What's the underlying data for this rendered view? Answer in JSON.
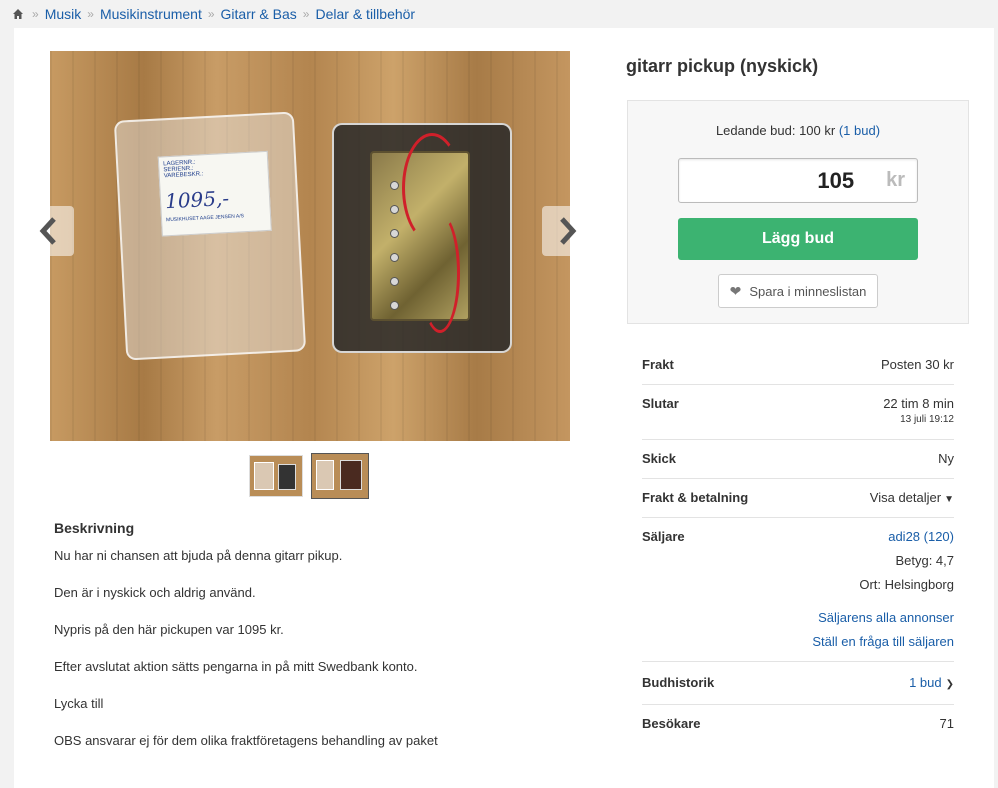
{
  "breadcrumb": {
    "home_icon": "home-icon",
    "items": [
      "Musik",
      "Musikinstrument",
      "Gitarr & Bas",
      "Delar & tillbehör"
    ],
    "separator": "»"
  },
  "listing": {
    "title": "gitarr pickup (nyskick)",
    "image": {
      "label_handwritten": "1095,-",
      "label_code": "SOPAFB1B",
      "label_lines": [
        "LAGERNR.:",
        "SERIENR.:",
        "VAREBESKR.:"
      ],
      "label_footer": "MUSIKHUSET AAGE JENSEN A/S"
    }
  },
  "bid": {
    "leading_label": "Ledande bud: 100 kr",
    "bid_count_link": "(1 bud)",
    "input_value": "105",
    "input_unit": "kr",
    "place_bid_label": "Lägg bud",
    "save_label": "Spara i minneslistan"
  },
  "details": {
    "shipping": {
      "label": "Frakt",
      "value": "Posten 30 kr"
    },
    "ends": {
      "label": "Slutar",
      "value": "22 tim 8 min",
      "sub": "13 juli 19:12"
    },
    "condition": {
      "label": "Skick",
      "value": "Ny"
    },
    "shipping_payment": {
      "label": "Frakt & betalning",
      "value": "Visa detaljer"
    },
    "seller": {
      "label": "Säljare",
      "name": "adi28 (120)",
      "rating": "Betyg: 4,7",
      "location": "Ort: Helsingborg",
      "all_listings": "Säljarens alla annonser",
      "ask_question": "Ställ en fråga till säljaren"
    },
    "bid_history": {
      "label": "Budhistorik",
      "value": "1 bud"
    },
    "visitors": {
      "label": "Besökare",
      "value": "71"
    }
  },
  "description": {
    "heading": "Beskrivning",
    "paragraphs": [
      "Nu har ni chansen att bjuda på denna gitarr pikup.",
      "Den är i nyskick och aldrig använd.",
      "Nypris på den här pickupen var 1095 kr.",
      "Efter avslutat aktion sätts pengarna in på mitt Swedbank konto.",
      "Lycka till",
      "OBS ansvarar ej för dem olika fraktföretagens behandling av paket"
    ]
  },
  "colors": {
    "link": "#1a5ea8",
    "bid_button": "#3cb371"
  }
}
